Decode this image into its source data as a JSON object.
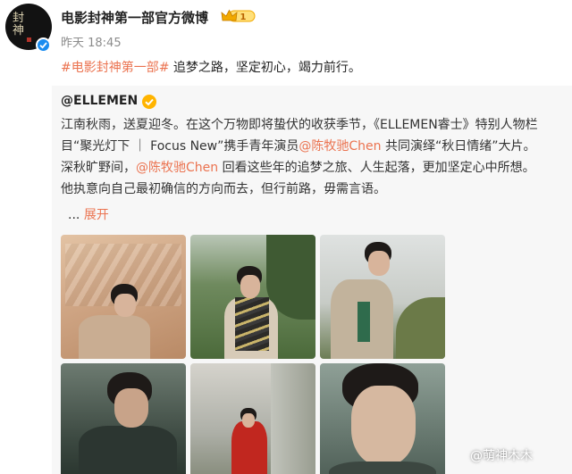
{
  "post": {
    "author": "电影封神第一部官方微博",
    "avatar_text": "封\n神",
    "member_level": "1",
    "time": "昨天 18:45",
    "topic": "#电影封神第一部#",
    "text": " 追梦之路，坚定初心，竭力前行。"
  },
  "repost": {
    "author": "@ELLEMEN",
    "lines": [
      [
        "江南秋雨，送夏迎冬。在这个万物即将蛰伏的收获季节，《ELLEMEN睿士》特别人物栏"
      ],
      [
        "目“聚光灯下 ｜ Focus New”携手青年演员",
        "@陈牧驰Chen",
        " 共同演绎“秋日情绪”大片。"
      ],
      [
        "深秋旷野间，",
        "@陈牧驰Chen",
        " 回看这些年的追梦之旅、人生起落，更加坚定心中所想。"
      ],
      [
        "他执意向自己最初确信的方向而去，但行前路，毋需言语。"
      ]
    ],
    "line1": "江南秋雨，送夏迎冬。在这个万物即将蛰伏的收获季节，《ELLEMEN睿士》特别人物栏",
    "line2a": "目“聚光灯下 ｜ Focus New”携手青年演员",
    "mention1": "@陈牧驰Chen",
    "line2b": " 共同演绎“秋日情绪”大片。",
    "line3a": "深秋旷野间，",
    "mention2": "@陈牧驰Chen",
    "line3b": " 回看这些年的追梦之旅、人生起落，更加坚定心中所想。",
    "line4": "他执意向自己最初确信的方向而去，但行前路，毋需言语。",
    "ellipsis": "...",
    "expand": "展开"
  },
  "watermark": "@萌神木木",
  "colors": {
    "link": "#eb7350",
    "verify_blue": "#1a8cf0",
    "verify_gold": "#ffb400",
    "repost_bg": "#f7f7f7"
  }
}
